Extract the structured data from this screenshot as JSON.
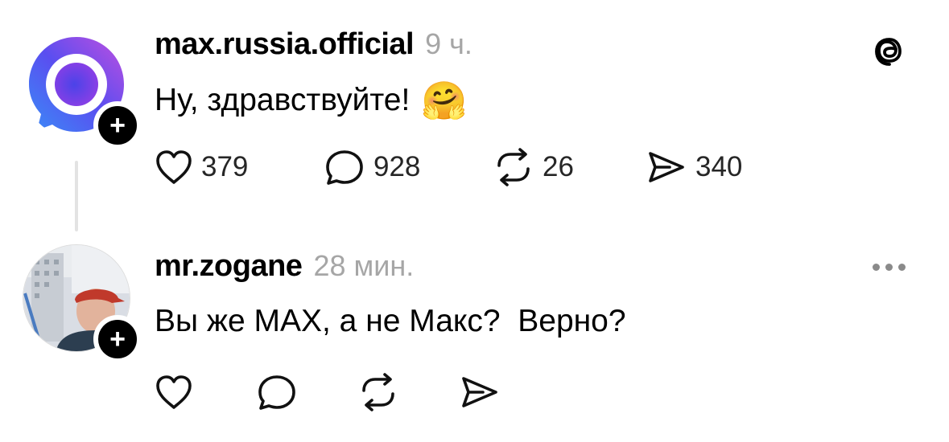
{
  "posts": [
    {
      "username": "max.russia.official",
      "time": "9 ч.",
      "text": "Ну, здравствуйте!",
      "emoji": "🤗",
      "likes": "379",
      "replies": "928",
      "reposts": "26",
      "shares": "340",
      "follow_label": "+"
    },
    {
      "username": "mr.zogane",
      "time": "28 мин.",
      "text": "Вы же MAX, а не Макс?  Верно?",
      "follow_label": "+"
    }
  ],
  "colors": {
    "accent_gradient": [
      "#3a63f5",
      "#a847e8",
      "#e04fd0"
    ],
    "muted_text": "#a6a6a6"
  },
  "icons": [
    "threads-logo-icon",
    "heart-icon",
    "comment-icon",
    "repost-icon",
    "share-icon",
    "more-icon"
  ]
}
